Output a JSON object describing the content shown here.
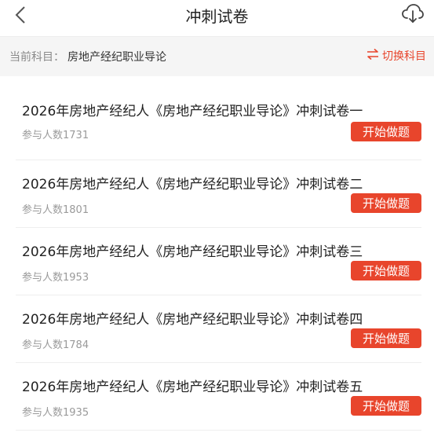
{
  "header": {
    "title": "冲刺试卷",
    "back_icon": "chevron-left-icon",
    "download_icon": "cloud-download-icon"
  },
  "subject": {
    "label": "当前科目：",
    "value": "房地产经纪职业导论",
    "switch_label": "切换科目",
    "switch_icon": "swap-arrows-icon"
  },
  "colors": {
    "accent": "#e8452c",
    "subject_bar_bg": "#f5f5f5"
  },
  "papers": [
    {
      "title": "2026年房地产经纪人《房地产经纪职业导论》冲刺试卷一",
      "count": "参与人数1731",
      "button": "开始做题"
    },
    {
      "title": "2026年房地产经纪人《房地产经纪职业导论》冲刺试卷二",
      "count": "参与人数1801",
      "button": "开始做题"
    },
    {
      "title": "2026年房地产经纪人《房地产经纪职业导论》冲刺试卷三",
      "count": "参与人数1953",
      "button": "开始做题"
    },
    {
      "title": "2026年房地产经纪人《房地产经纪职业导论》冲刺试卷四",
      "count": "参与人数1784",
      "button": "开始做题"
    },
    {
      "title": "2026年房地产经纪人《房地产经纪职业导论》冲刺试卷五",
      "count": "参与人数1935",
      "button": "开始做题"
    }
  ]
}
